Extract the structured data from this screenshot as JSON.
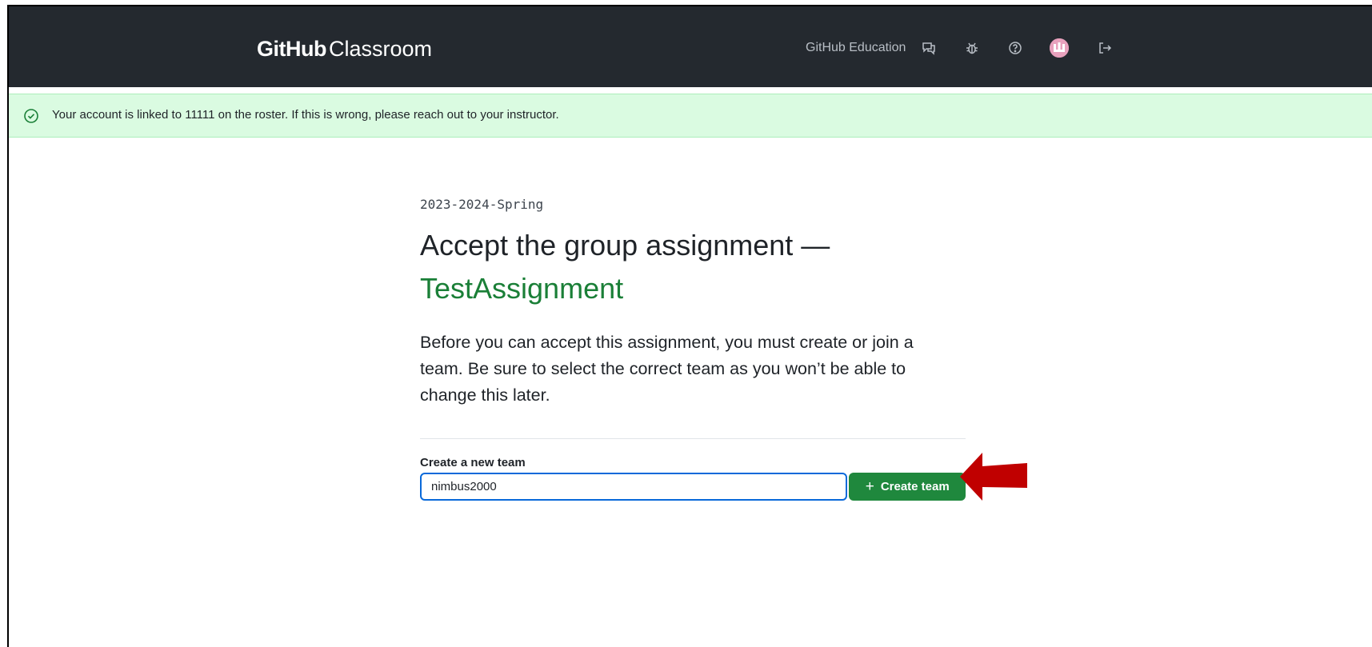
{
  "header": {
    "brand_strong": "GitHub",
    "brand_light": "Classroom",
    "nav_link": "GitHub Education",
    "icons": [
      "feedback-icon",
      "bug-icon",
      "help-icon",
      "avatar",
      "sign-out-icon"
    ]
  },
  "flash": {
    "message": "Your account is linked to 11111 on the roster. If this is wrong, please reach out to your instructor.",
    "icon": "check-circle-icon"
  },
  "main": {
    "classroom_name": "2023-2024-Spring",
    "title_prefix": "Accept the group assignment —",
    "assignment_name": "TestAssignment",
    "description": "Before you can accept this assignment, you must create or join a team. Be sure to select the correct team as you won’t be able to change this later.",
    "form": {
      "label": "Create a new team",
      "input_value": "nimbus2000",
      "button_label": "Create team",
      "button_icon": "+"
    }
  },
  "colors": {
    "header_bg": "#24292f",
    "flash_bg": "#dafbe1",
    "success_green": "#1a7f37",
    "button_green": "#1f883d",
    "focus_blue": "#0969da",
    "annotation_arrow": "#c00000"
  }
}
